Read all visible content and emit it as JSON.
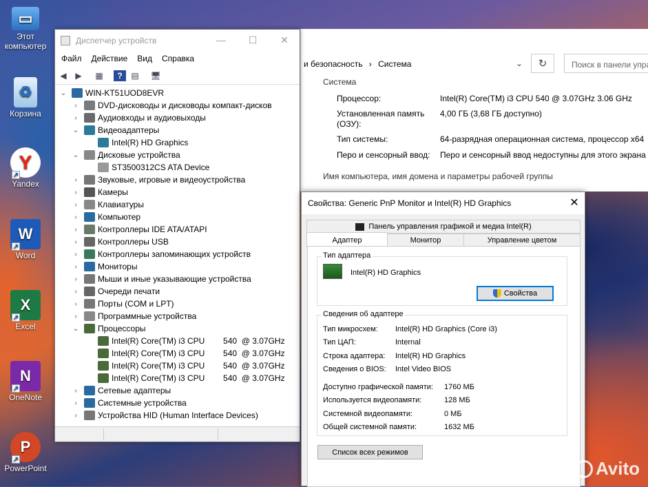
{
  "desktop": {
    "icons": [
      {
        "label": "Этот компьютер",
        "icon": "computer-icon"
      },
      {
        "label": "Корзина",
        "icon": "recycle-bin-icon"
      },
      {
        "label": "Yandex",
        "icon": "yandex-icon"
      },
      {
        "label": "Word",
        "icon": "word-icon"
      },
      {
        "label": "Excel",
        "icon": "excel-icon"
      },
      {
        "label": "OneNote",
        "icon": "onenote-icon"
      },
      {
        "label": "PowerPoint",
        "icon": "powerpoint-icon"
      }
    ],
    "watermark": "Avito"
  },
  "system_window": {
    "breadcrumb_part1": "и безопасность",
    "breadcrumb_sep": "›",
    "breadcrumb_part2": "Система",
    "search_placeholder": "Поиск в панели управления",
    "section_system": "Система",
    "rows": [
      {
        "label": "Процессор:",
        "value": "Intel(R) Core(TM) i3 CPU        540  @ 3.07GHz   3.06 GHz"
      },
      {
        "label": "Установленная память",
        "value": "4,00 ГБ (3,68 ГБ доступно)"
      },
      {
        "label": "(ОЗУ):",
        "value": ""
      },
      {
        "label": "Тип системы:",
        "value": "64-разрядная операционная система, процессор x64"
      },
      {
        "label": "Перо и сенсорный ввод:",
        "value": "Перо и сенсорный ввод недоступны для этого экрана"
      }
    ],
    "section_name": "Имя компьютера, имя домена и параметры рабочей группы"
  },
  "device_manager": {
    "title": "Диспетчер устройств",
    "menu": [
      "Файл",
      "Действие",
      "Вид",
      "Справка"
    ],
    "root": "WIN-KT51UOD8EVR",
    "nodes": [
      {
        "label": "DVD-дисководы и дисководы компакт-дисков",
        "level": 1,
        "expanded": false,
        "color": "#7a7a7a"
      },
      {
        "label": "Аудиовходы и аудиовыходы",
        "level": 1,
        "expanded": false,
        "color": "#6a6a6a"
      },
      {
        "label": "Видеоадаптеры",
        "level": 1,
        "expanded": true,
        "color": "#2a7a9a"
      },
      {
        "label": "Intel(R) HD Graphics",
        "level": 2,
        "expanded": null,
        "color": "#2a7a9a"
      },
      {
        "label": "Дисковые устройства",
        "level": 1,
        "expanded": true,
        "color": "#888888"
      },
      {
        "label": "ST3500312CS ATA Device",
        "level": 2,
        "expanded": null,
        "color": "#999999"
      },
      {
        "label": "Звуковые, игровые и видеоустройства",
        "level": 1,
        "expanded": false,
        "color": "#777777"
      },
      {
        "label": "Камеры",
        "level": 1,
        "expanded": false,
        "color": "#555555"
      },
      {
        "label": "Клавиатуры",
        "level": 1,
        "expanded": false,
        "color": "#888888"
      },
      {
        "label": "Компьютер",
        "level": 1,
        "expanded": false,
        "color": "#2a6aa0"
      },
      {
        "label": "Контроллеры IDE ATA/ATAPI",
        "level": 1,
        "expanded": false,
        "color": "#6a7a6a"
      },
      {
        "label": "Контроллеры USB",
        "level": 1,
        "expanded": false,
        "color": "#666666"
      },
      {
        "label": "Контроллеры запоминающих устройств",
        "level": 1,
        "expanded": false,
        "color": "#3a7a5a"
      },
      {
        "label": "Мониторы",
        "level": 1,
        "expanded": false,
        "color": "#2a6aa0"
      },
      {
        "label": "Мыши и иные указывающие устройства",
        "level": 1,
        "expanded": false,
        "color": "#777777"
      },
      {
        "label": "Очереди печати",
        "level": 1,
        "expanded": false,
        "color": "#666666"
      },
      {
        "label": "Порты (COM и LPT)",
        "level": 1,
        "expanded": false,
        "color": "#777777"
      },
      {
        "label": "Программные устройства",
        "level": 1,
        "expanded": false,
        "color": "#888888"
      },
      {
        "label": "Процессоры",
        "level": 1,
        "expanded": true,
        "color": "#4a6a3a"
      },
      {
        "label": "Intel(R) Core(TM) i3 CPU        540  @ 3.07GHz",
        "level": 2,
        "expanded": null,
        "color": "#4a6a3a"
      },
      {
        "label": "Intel(R) Core(TM) i3 CPU        540  @ 3.07GHz",
        "level": 2,
        "expanded": null,
        "color": "#4a6a3a"
      },
      {
        "label": "Intel(R) Core(TM) i3 CPU        540  @ 3.07GHz",
        "level": 2,
        "expanded": null,
        "color": "#4a6a3a"
      },
      {
        "label": "Intel(R) Core(TM) i3 CPU        540  @ 3.07GHz",
        "level": 2,
        "expanded": null,
        "color": "#4a6a3a"
      },
      {
        "label": "Сетевые адаптеры",
        "level": 1,
        "expanded": false,
        "color": "#2a6aa0"
      },
      {
        "label": "Системные устройства",
        "level": 1,
        "expanded": false,
        "color": "#2a6aa0"
      },
      {
        "label": "Устройства HID (Human Interface Devices)",
        "level": 1,
        "expanded": false,
        "color": "#777777"
      }
    ]
  },
  "properties": {
    "title": "Свойства: Generic PnP Monitor и Intel(R) HD Graphics",
    "tab_top": "Панель управления графикой и медиа Intel(R)",
    "tabs": [
      "Адаптер",
      "Монитор",
      "Управление цветом"
    ],
    "adapter_type_label": "Тип адаптера",
    "adapter_name": "Intel(R) HD Graphics",
    "properties_button": "Свойства",
    "info_label": "Сведения об адаптере",
    "info_rows": [
      {
        "label": "Тип микросхем:",
        "value": "Intel(R) HD Graphics (Core i3)"
      },
      {
        "label": "Тип ЦАП:",
        "value": "Internal"
      },
      {
        "label": "Строка адаптера:",
        "value": "Intel(R) HD Graphics"
      },
      {
        "label": "Сведения о BIOS:",
        "value": "Intel Video BIOS"
      }
    ],
    "mem_rows": [
      {
        "label": "Доступно графической памяти:",
        "value": "1760 МБ"
      },
      {
        "label": "Используется видеопамяти:",
        "value": "128 МБ"
      },
      {
        "label": "Системной видеопамяти:",
        "value": "0 МБ"
      },
      {
        "label": "Общей системной памяти:",
        "value": "1632 МБ"
      }
    ],
    "list_modes_button": "Список всех режимов"
  }
}
